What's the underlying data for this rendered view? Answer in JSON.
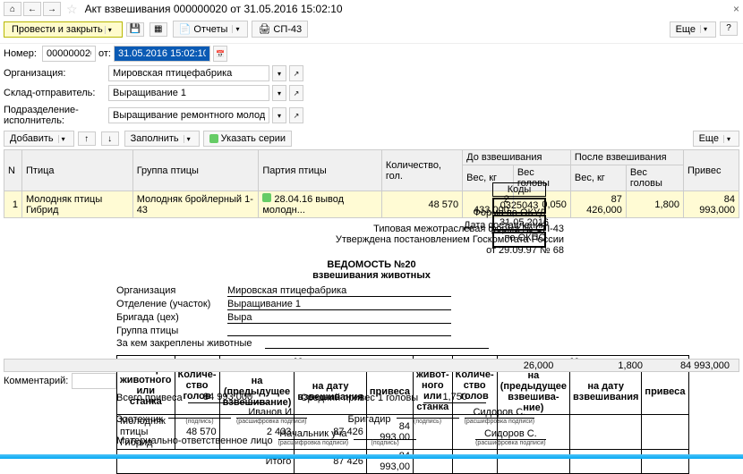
{
  "header": {
    "title": "Акт взвешивания 000000020 от 31.05.2016 15:02:10"
  },
  "toolbar": {
    "main": "Провести и закрыть",
    "reports": "Отчеты",
    "sp43": "СП-43",
    "more": "Еще"
  },
  "form": {
    "num_l": "Номер:",
    "num_v": "000000020",
    "dt_l": "от:",
    "dt_v": "31.05.2016 15:02:10",
    "org_l": "Организация:",
    "org_v": "Мировская птицефабрика",
    "skl_l": "Склад-отправитель:",
    "skl_v": "Выращивание 1",
    "pod_l": "Подразделение-исполнитель:",
    "pod_v": "Выращивание ремонтного молодняка"
  },
  "tbtools": {
    "add": "Добавить",
    "fill": "Заполнить",
    "series": "Указать серии",
    "more": "Еще"
  },
  "grid": {
    "h": {
      "n": "N",
      "bird": "Птица",
      "group": "Группа птицы",
      "party": "Партия птицы",
      "qty": "Количество, гол.",
      "before": "До взвешивания",
      "after": "После взвешивания",
      "gain": "Привес",
      "wkg": "Вес, кг",
      "whead": "Вес головы"
    },
    "r1": {
      "n": "1",
      "bird": "Молодняк птицы Гибрид",
      "group": "Молодняк бройлерный 1-43",
      "party": "28.04.16 вывод молодн...",
      "qty": "48 570",
      "bwkg": "2 433,000",
      "bwh": "0,050",
      "awkg": "87 426,000",
      "awh": "1,800",
      "gain": "84 993,000"
    }
  },
  "doc": {
    "h1": "Типовая межотраслевая форма № СП-43",
    "h2": "Утверждена постановлением Госкомстата России",
    "h3": "от 29.09.97 № 68",
    "t1": "ВЕДОМОСТЬ №20",
    "t2": "взвешивания животных",
    "kody": "Коды",
    "okud": "0325043",
    "date": "31.05.2016",
    "okud_l": "Форма по ОКУД",
    "date_l": "Дата составления",
    "okpo_l": "по ОКПО",
    "org_l": "Организация",
    "org_v": "Мировская птицефабрика",
    "otd_l": "Отделение (участок)",
    "otd_v": "Выращивание 1",
    "brig_l": "Бригада (цех)",
    "brig_v": "Выра",
    "grp_l": "Группа птицы",
    "zakr_l": "За кем закреплены животные"
  },
  "vtab": {
    "num": "Номер животного или станка",
    "qty": "Количе-ство голов",
    "mass": "Масса, кг",
    "prev": "на (предыдущее взвешивание)",
    "curr": "на дату взвешивания",
    "gain": "привеса",
    "num2": "Номер живот-ного или станка",
    "qty2": "Количе-ство голов",
    "prev2": "на (предыдущее взвешива-ние)",
    "curr2": "на дату взвешивания",
    "gain2": "привеса",
    "r": {
      "name": "Молодняк птицы Гибрид",
      "qty": "48 570",
      "prev": "2 433",
      "curr": "87 426",
      "gain": "84 993,00"
    },
    "tot_l": "Итого",
    "tot_c": "87 426",
    "tot_g": "84 993,00"
  },
  "ftot": {
    "a": "26,000",
    "b": "1,800",
    "c": "84 993,000"
  },
  "comment_l": "Комментарий:",
  "sig": {
    "vsego": "Всего привеса",
    "vsego_v": "84 993,000",
    "avg": "Средний привес 1 головы",
    "avg_v": "1,750",
    "zoo": "Зоотехник",
    "zoo_v": "Иванов И.",
    "brig": "Бригадир",
    "brig_v": "Сидоров С.",
    "mol": "Материально-ответственное лицо",
    "mol_v": "Начальник уча",
    "mol2_v": "Сидоров С.",
    "p": "(подпись)",
    "r": "(расшифровка подписи)"
  },
  "chart_data": {
    "type": "table",
    "title": "Ведомость №20 взвешивания животных",
    "columns": [
      "Номер животного",
      "Кол-во голов",
      "Масса на пред. взвеш., кг",
      "Масса на дату взвеш., кг",
      "Привес, кг"
    ],
    "rows": [
      [
        "Молодняк птицы Гибрид",
        48570,
        2433,
        87426,
        84993.0
      ]
    ],
    "totals": {
      "curr": 87426,
      "gain": 84993.0
    }
  }
}
